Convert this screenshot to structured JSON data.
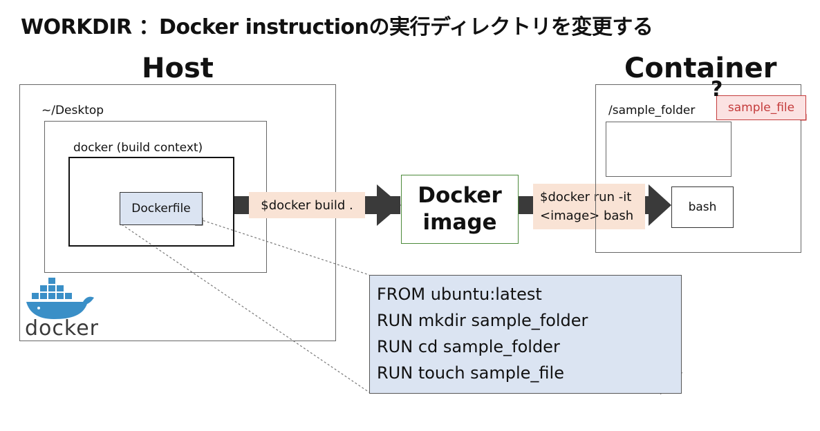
{
  "title": "WORKDIR ：Docker instructionの実行ディレクトリを変更する",
  "host": {
    "label": "Host",
    "desktop_label": "~/Desktop",
    "docker_label": "docker (build context)",
    "dockerfile_label": "Dockerfile",
    "logo_word": "docker"
  },
  "container": {
    "label": "Container",
    "folder_label": "/sample_folder",
    "sample_file_label": "sample_file",
    "question_mark": "?",
    "bash_label": "bash"
  },
  "image": {
    "line1": "Docker",
    "line2": "image"
  },
  "commands": {
    "build": "$docker build .",
    "run_line1": "$docker run -it",
    "run_line2": "<image> bash"
  },
  "dockerfile_contents": [
    "FROM ubuntu:latest",
    "RUN mkdir sample_folder",
    "RUN cd sample_folder",
    "RUN touch sample_file"
  ],
  "colors": {
    "arrow": "#3a3a3a",
    "command_bg": "#f9e3d5",
    "note_bg": "#dbe4f2",
    "image_border": "#4c8a3a",
    "sample_file_red": "#c43b3b",
    "docker_blue": "#3a8fc7"
  }
}
